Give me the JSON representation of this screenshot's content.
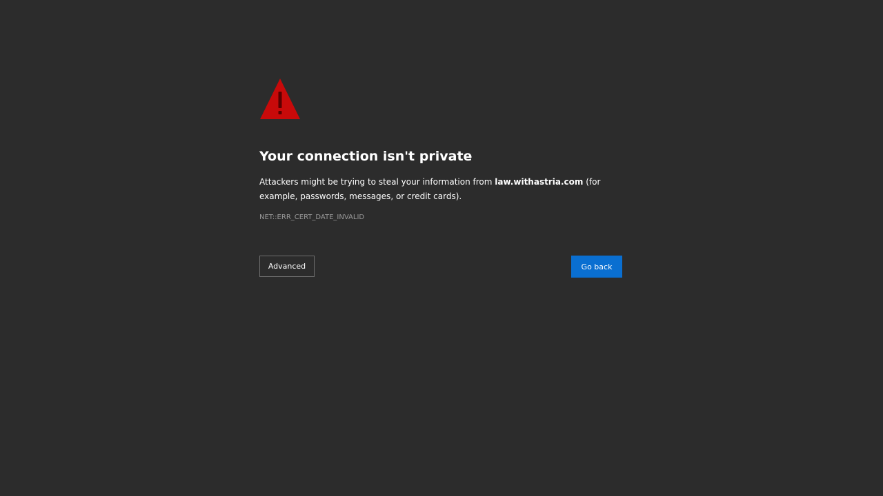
{
  "warning": {
    "icon": "warning-triangle-icon",
    "color": "#c80a0a"
  },
  "title": "Your connection isn't private",
  "message": {
    "before": "Attackers might be trying to steal your information from ",
    "domain": "law.withastria.com",
    "after": " (for example, passwords, messages, or credit cards)."
  },
  "error_code": "NET::ERR_CERT_DATE_INVALID",
  "buttons": {
    "advanced_label": "Advanced",
    "go_back_label": "Go back",
    "go_back_color": "#0a6fd1"
  }
}
